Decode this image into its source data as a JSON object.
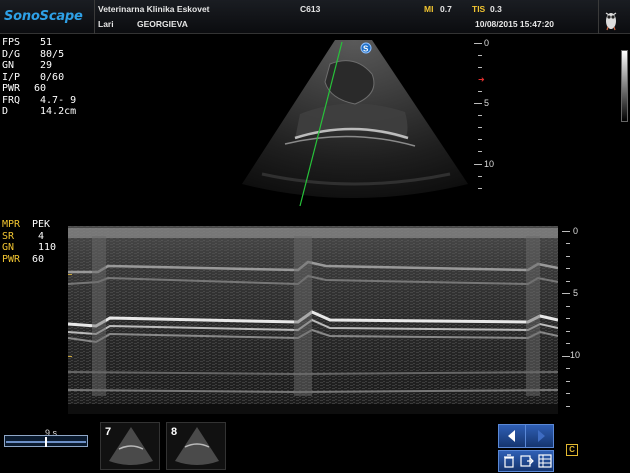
{
  "header": {
    "brand": "SonoScape",
    "clinic": "Veterinarna Klinika Eskovet",
    "patient_first": "Lari",
    "patient_last": "GEORGIEVA",
    "probe": "C613",
    "mi_label": "MI",
    "mi_value": "0.7",
    "tis_label": "TIS",
    "tis_value": "0.3",
    "datetime": "10/08/2015 15:47:20"
  },
  "bmode_params": [
    {
      "k": "FPS",
      "v": " 51"
    },
    {
      "k": "D/G",
      "v": " 80/5"
    },
    {
      "k": "GN",
      "v": " 29"
    },
    {
      "k": "I/P",
      "v": " 0/60"
    },
    {
      "k": "PWR",
      "v": "60"
    },
    {
      "k": "FRQ",
      "v": " 4.7- 9"
    },
    {
      "k": "D",
      "v": " 14.2cm"
    }
  ],
  "mmode_params": [
    {
      "k": "MPR",
      "v": "PEK"
    },
    {
      "k": "SR",
      "v": " 4"
    },
    {
      "k": "GN",
      "v": " 110"
    },
    {
      "k": "PWR",
      "v": "60"
    }
  ],
  "bmode_scale": [
    "0",
    "5",
    "10"
  ],
  "mmode_scale": [
    "0",
    "5",
    "10"
  ],
  "cine": {
    "label": "9 s",
    "position": 0.5
  },
  "thumbnails": [
    {
      "num": "7"
    },
    {
      "num": "8"
    }
  ],
  "controls": {
    "badge": "C"
  },
  "colors": {
    "brand": "#2ea0e6",
    "accent_yellow": "#f2c531",
    "mline": "#27c23a",
    "control_blue": "#2f5fb5"
  },
  "icons": [
    "owl-logo-icon",
    "arrow-left-icon",
    "arrow-right-icon",
    "trash-icon",
    "export-icon",
    "grid-icon",
    "probe-orientation-icon"
  ]
}
